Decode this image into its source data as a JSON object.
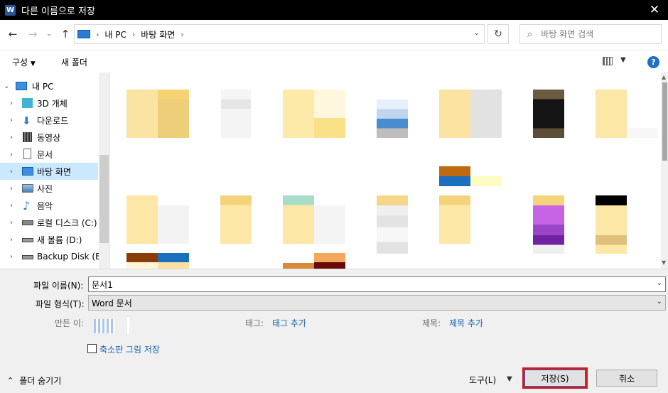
{
  "window": {
    "title": "다른 이름으로 저장",
    "app_icon": "W"
  },
  "address": {
    "crumbs": [
      "내 PC",
      "바탕 화면"
    ],
    "search_placeholder": "바탕 화면 검색"
  },
  "toolbar": {
    "organize": "구성",
    "new_folder": "새 폴더"
  },
  "nav": {
    "items": [
      {
        "label": "내 PC",
        "icon": "pc-icon"
      },
      {
        "label": "3D 개체",
        "icon": "cube-3d-icon"
      },
      {
        "label": "다운로드",
        "icon": "download-icon"
      },
      {
        "label": "동영상",
        "icon": "video-icon"
      },
      {
        "label": "문서",
        "icon": "document-icon"
      },
      {
        "label": "바탕 화면",
        "icon": "desktop-icon"
      },
      {
        "label": "사진",
        "icon": "pictures-icon"
      },
      {
        "label": "음악",
        "icon": "music-icon"
      },
      {
        "label": "로컬 디스크 (C:)",
        "icon": "local-disk-icon"
      },
      {
        "label": "새 볼륨 (D:)",
        "icon": "drive-icon"
      },
      {
        "label": "Backup Disk (E:)",
        "icon": "drive-icon"
      }
    ]
  },
  "form": {
    "filename_label": "파일 이름(N):",
    "filename_value": "문서1",
    "filetype_label": "파일 형식(T):",
    "filetype_value": "Word 문서",
    "author_label": "만든 이:",
    "tags_label": "태그:",
    "tags_link": "태그 추가",
    "title_label": "제목:",
    "title_link": "제목 추가",
    "thumbnail_checkbox": "축소판 그림 저장"
  },
  "footer": {
    "hide_folders": "폴더 숨기기",
    "tools": "도구(L)",
    "save": "저장(S)",
    "cancel": "취소"
  },
  "colors": {
    "accent": "#1a64b0",
    "highlight": "#e0141c",
    "selected": "#cce8ff"
  }
}
